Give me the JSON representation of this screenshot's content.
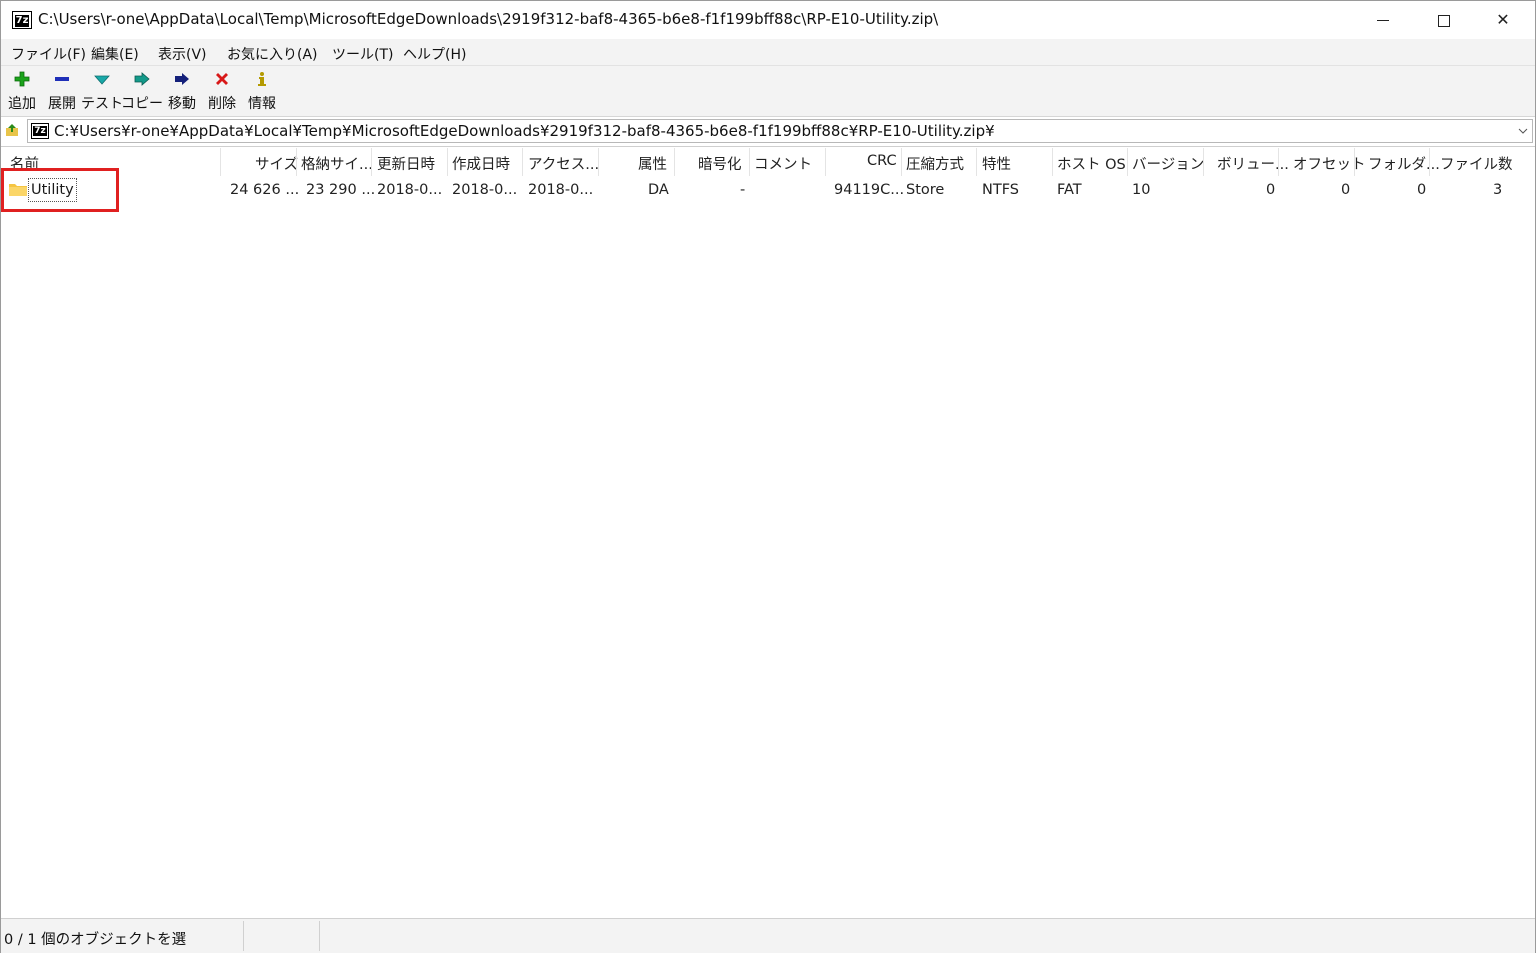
{
  "window": {
    "title": "C:\\Users\\r-one\\AppData\\Local\\Temp\\MicrosoftEdgeDownloads\\2919f312-baf8-4365-b6e8-f1f199bff88c\\RP-E10-Utility.zip\\",
    "app_icon_text": "7z",
    "controls": {
      "minimize": "minimize",
      "maximize": "maximize",
      "close": "✕"
    }
  },
  "menu": [
    "ファイル(F)",
    "編集(E)",
    "表示(V)",
    "お気に入り(A)",
    "ツール(T)",
    "ヘルプ(H)"
  ],
  "toolbar": [
    {
      "label": "追加",
      "icon": "plus-icon",
      "color": "#1aa31a"
    },
    {
      "label": "展開",
      "icon": "minus-icon",
      "color": "#1f2fb8"
    },
    {
      "label": "テスト",
      "icon": "check-icon",
      "color": "#19a8a8"
    },
    {
      "label": "コピー",
      "icon": "copy-arrow-icon",
      "color": "#139a8a"
    },
    {
      "label": "移動",
      "icon": "move-arrow-icon",
      "color": "#14207a"
    },
    {
      "label": "削除",
      "icon": "delete-x-icon",
      "color": "#d81818"
    },
    {
      "label": "情報",
      "icon": "info-icon",
      "color": "#b49a00"
    }
  ],
  "address": {
    "path": "C:¥Users¥r-one¥AppData¥Local¥Temp¥MicrosoftEdgeDownloads¥2919f312-baf8-4365-b6e8-f1f199bff88c¥RP-E10-Utility.zip¥",
    "icon_text": "7z"
  },
  "columns": [
    "名前",
    "サイズ",
    "格納サイ...",
    "更新日時",
    "作成日時",
    "アクセス...",
    "属性",
    "暗号化",
    "コメント",
    "CRC",
    "圧縮方式",
    "特性",
    "ホスト OS",
    "バージョン",
    "ボリュー...",
    "オフセット",
    "フォルダ...",
    "ファイル数"
  ],
  "rows": [
    {
      "name": "Utility",
      "size": "24 626 ...",
      "packed": "23 290 ...",
      "modified": "2018-0...",
      "created": "2018-0...",
      "accessed": "2018-0...",
      "attributes": "DA",
      "encrypted": "-",
      "comment": "",
      "crc": "94119C...",
      "method": "Store",
      "characteristics": "NTFS",
      "host_os": "FAT",
      "version": "10",
      "volume": "0",
      "offset": "0",
      "folders": "0",
      "files": "3"
    }
  ],
  "status": {
    "selection": "0 / 1 個のオブジェクトを選"
  },
  "colors": {
    "highlight": "#e02020",
    "folder": "#f5c542"
  }
}
